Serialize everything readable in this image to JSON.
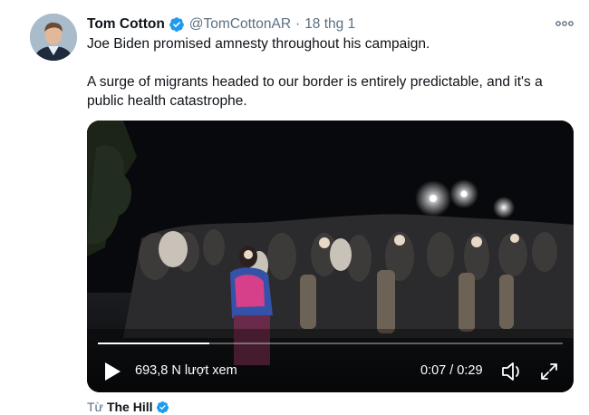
{
  "tweet": {
    "author_name": "Tom Cotton",
    "author_handle": "@TomCottonAR",
    "separator": "·",
    "timestamp": "18 thg 1",
    "verified": true,
    "more_icon": "more-horizontal-icon",
    "paragraphs": [
      "Joe Biden promised amnesty throughout his campaign.",
      "A surge of migrants headed to our border is entirely predictable, and it's a public health catastrophe."
    ]
  },
  "video": {
    "views": "693,8 N lượt xem",
    "time": "0:07 / 0:29",
    "progress": 0.24,
    "play_icon": "play-icon",
    "volume_icon": "volume-icon",
    "fullscreen_icon": "fullscreen-icon"
  },
  "source": {
    "prefix": "Từ",
    "name": "The Hill",
    "verified": true
  },
  "colors": {
    "verified_blue": "#1d9bf0",
    "secondary_text": "#5b7083",
    "primary_text": "#0f1419"
  }
}
